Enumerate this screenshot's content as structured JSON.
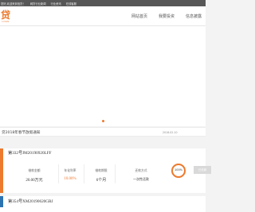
{
  "topbar": {
    "items": [
      "您好,欢迎来到信贷！",
      "网贷行业新闻",
      "行业资讯",
      "在线客服"
    ]
  },
  "header": {
    "logo_text": "贷",
    "logo_sub": "LOAN",
    "nav": [
      "网站首页",
      "我要投资",
      "信息披露"
    ]
  },
  "banner": {
    "dots": 1,
    "active_dot": 0
  },
  "notice": {
    "title": "贷2018年春节放假通知",
    "date": "2018-02-10"
  },
  "loans": [
    {
      "title": "第332号JM20190920LFF",
      "metrics": [
        {
          "label": "借款金额",
          "value": "20.00万元"
        },
        {
          "label": "年化利率",
          "value": "10.00%"
        },
        {
          "label": "借款期限",
          "value": "6个月"
        },
        {
          "label": "还款方式",
          "value": "一次性还款"
        }
      ],
      "progress": 100,
      "progress_text": "100%",
      "button_label": "已还款"
    },
    {
      "title": "第354号XM20190620GRJ"
    }
  ],
  "colors": {
    "accent_orange": "#ed7a2e",
    "accent_blue": "#2c73b1",
    "button_disabled": "#d9d9d9"
  }
}
